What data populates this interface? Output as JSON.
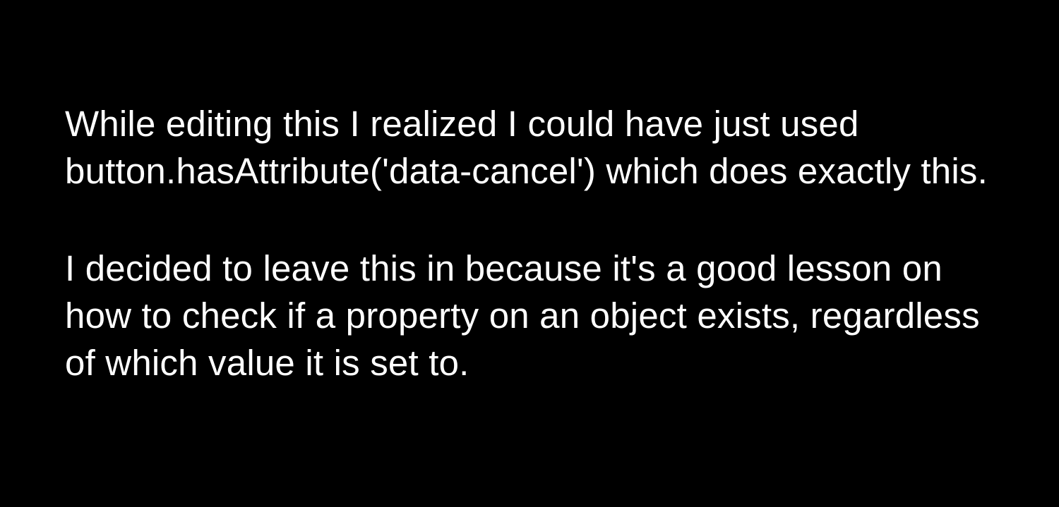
{
  "slide": {
    "paragraph1": "While editing this I realized I could have just used button.hasAttribute('data-cancel') which does exactly this.",
    "paragraph2": "I decided to leave this in because it's a good lesson on how to check if a property on an object exists, regardless of which value it is set to."
  }
}
